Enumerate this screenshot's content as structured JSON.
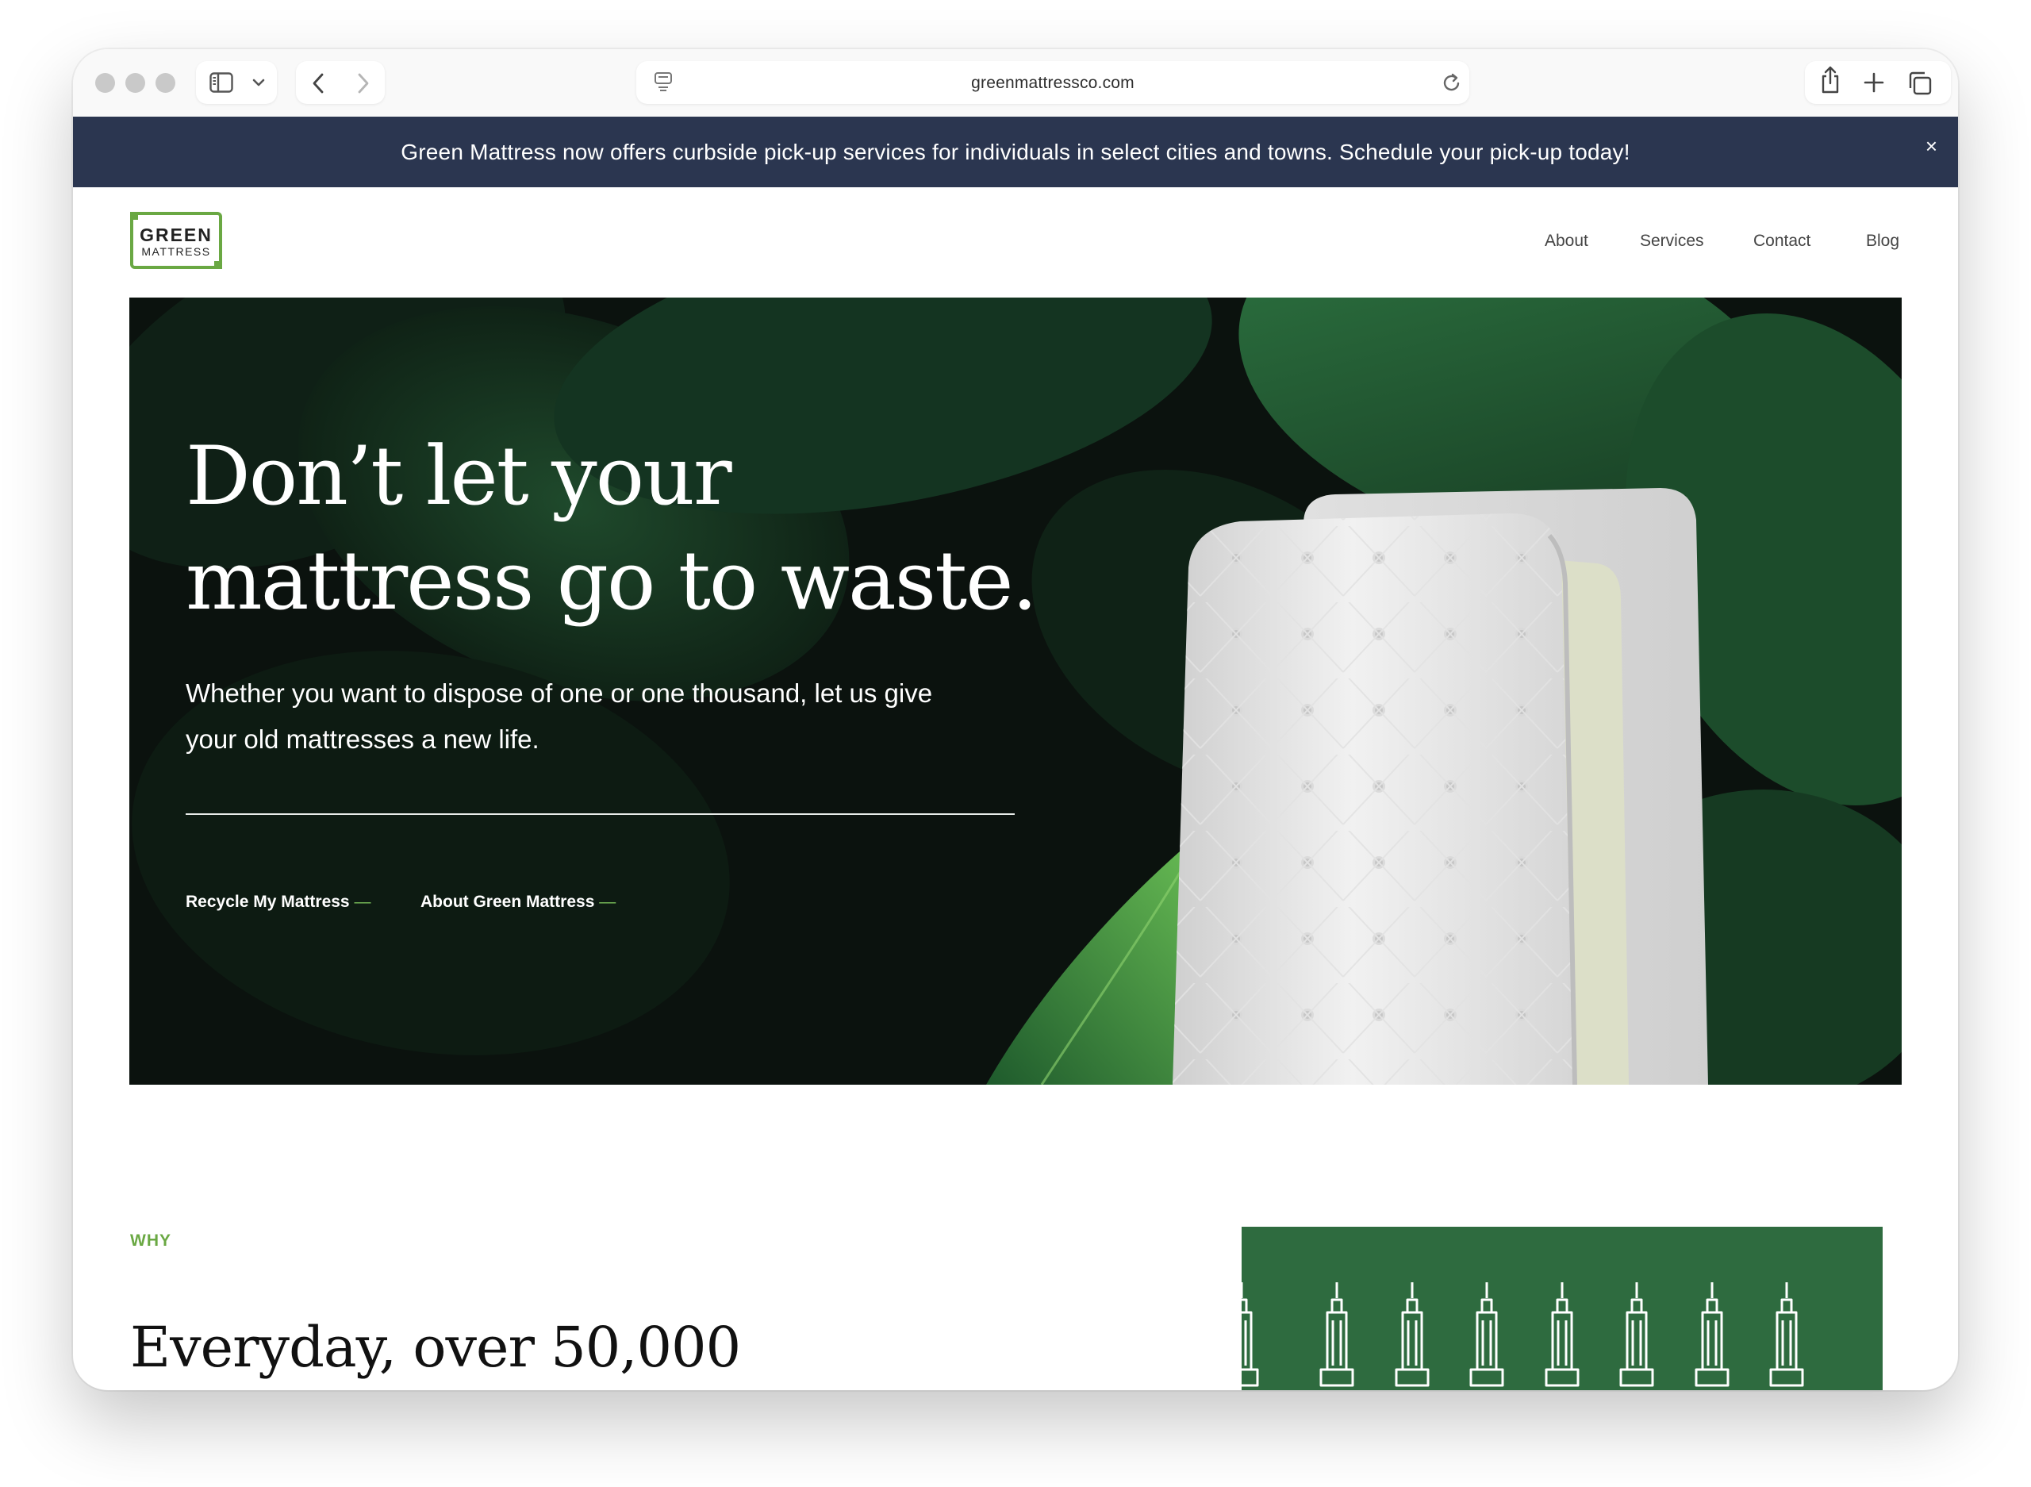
{
  "browser": {
    "url": "greenmattressco.com",
    "icons": [
      "sidebar-icon",
      "chevron-down-icon",
      "back-icon",
      "forward-icon",
      "site-settings-icon",
      "reload-icon",
      "share-icon",
      "new-tab-icon",
      "tabs-overview-icon"
    ]
  },
  "announcement": {
    "text": "Green Mattress now offers curbside pick-up services for individuals in select cities and towns. Schedule your pick-up today!",
    "close": "×"
  },
  "logo": {
    "line1": "GREEN",
    "line2": "MATTRESS"
  },
  "nav": {
    "items": [
      "About",
      "Services",
      "Contact",
      "Blog"
    ]
  },
  "hero": {
    "title_line1": "Don’t let your",
    "title_line2": "mattress go to waste.",
    "subtitle_line1": "Whether you want to dispose of one or one thousand, let us give",
    "subtitle_line2": "your old mattresses a new life.",
    "links": [
      {
        "label": "Recycle My Mattress",
        "suffix": "—"
      },
      {
        "label": "About Green Mattress",
        "suffix": "—"
      }
    ]
  },
  "why": {
    "label": "WHY",
    "heading": "Everyday, over 50,000"
  },
  "colors": {
    "announcement_bg": "#2b3650",
    "brand_green": "#6aa843",
    "card_green": "#2e6b3f",
    "hero_bg": "#0b120e"
  }
}
